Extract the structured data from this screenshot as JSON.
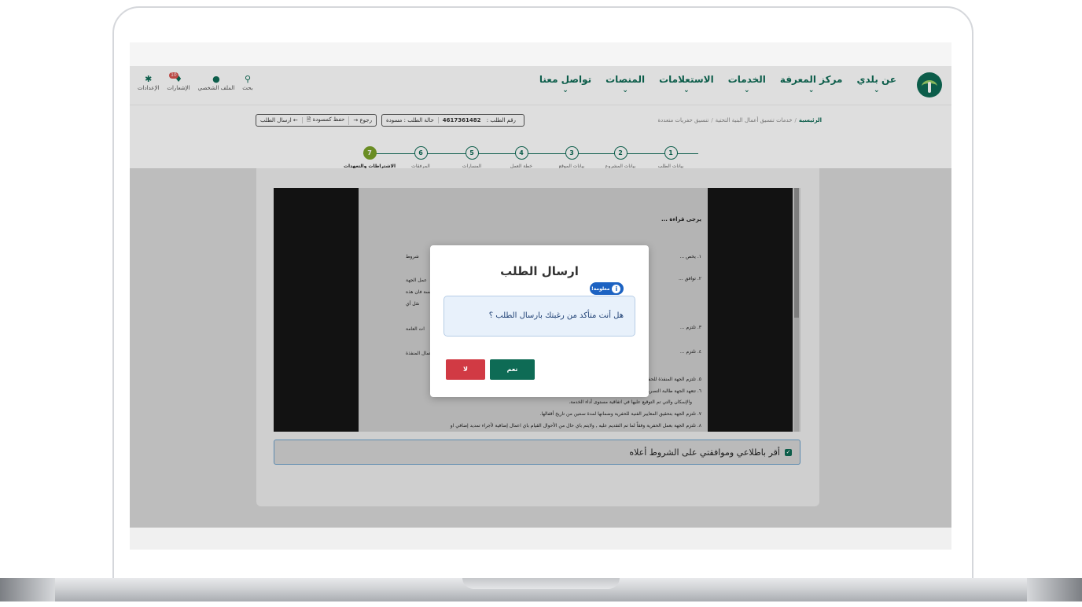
{
  "header": {
    "nav": [
      {
        "label": "عن بلدي"
      },
      {
        "label": "مركز المعرفة"
      },
      {
        "label": "الخدمات"
      },
      {
        "label": "الاستعلامات"
      },
      {
        "label": "المنصات"
      },
      {
        "label": "تواصل معنا"
      }
    ],
    "tools": [
      {
        "label": "بحث",
        "icon": "search-icon"
      },
      {
        "label": "الملف الشخصي",
        "icon": "user-icon"
      },
      {
        "label": "الإشعارات",
        "icon": "bell-icon",
        "badge": "10"
      },
      {
        "label": "الإعدادات",
        "icon": "gear-icon"
      }
    ]
  },
  "breadcrumb": {
    "home": "الرئيسية",
    "service": "خدمات تنسيق أعمال البنية التحتية",
    "current": "تنسيق حفريات متعددة"
  },
  "request": {
    "number_label": "رقم الطلب :",
    "number": "4617361482",
    "status": "حالة الطلب : مسودة"
  },
  "actions": {
    "back": "رجوع",
    "save_draft": "حفظ كمسودة",
    "send": "ارسال الطلب"
  },
  "steps": [
    {
      "num": "1",
      "label": "بيانات الطلب"
    },
    {
      "num": "2",
      "label": "بيانات المشروع"
    },
    {
      "num": "3",
      "label": "بيانات الموقع"
    },
    {
      "num": "4",
      "label": "خطة العمل"
    },
    {
      "num": "5",
      "label": "المسارات"
    },
    {
      "num": "6",
      "label": "المرفقات"
    },
    {
      "num": "7",
      "label": "الاشتراطات والتعهدات"
    }
  ],
  "terms": {
    "intro": "يرجى قراءة ...",
    "lines": [
      "١.  يخص ...",
      "٢.  توافق ...",
      "٣.  تلتزم ...",
      "٤.  تلتزم ...",
      "٥.  تلتزم الجهة المنفذة للحفرية بتطبيق الدليل المبسط للتشوه البصري الحواجز الخرسانية للحد من عناصر التشوه البصري.",
      "٦.  تتعهد الجهة طالبة التصريح بأقفال الحفرية وفقاً للشروط والمواصفات الفنية المعتمدة من وزارة الشؤون البلدية والقروية",
      "والإسكان والتي تم التوقيع عليها في اتفاقية مستوى أداء الخدمة.",
      "٧.  تلتزم الجهة بتحقيق المعايير الفنية للحفرية وضمانها لمدة سنتين من تاريخ أقفالها.",
      "٨.  تلتزم الجهة بعمل الحفرية وفقاً لما تم التقديم عليه , ولايتم باي حال من الأحوال القيام باي اعمال إضافية لأجراء تمديد إضافي او"
    ],
    "left_snippets": [
      "شروط",
      "عمل الجهة",
      "مسة فان هذه",
      "نقل أي",
      "ات العامة",
      "عمال المنفذة"
    ]
  },
  "agreement": {
    "label": "أقر باطلاعي وموافقتي على الشروط أعلاه",
    "checked": true
  },
  "modal": {
    "title": "ارسال الطلب",
    "info_tag": "معلومة!",
    "message": "هل أنت متأكد من رغبتك بارسال الطلب ؟",
    "yes": "نعم",
    "no": "لا"
  },
  "colors": {
    "primary": "#0e6b55",
    "active_step": "#7aa22a",
    "danger": "#d13a44",
    "info": "#1c62c2"
  }
}
